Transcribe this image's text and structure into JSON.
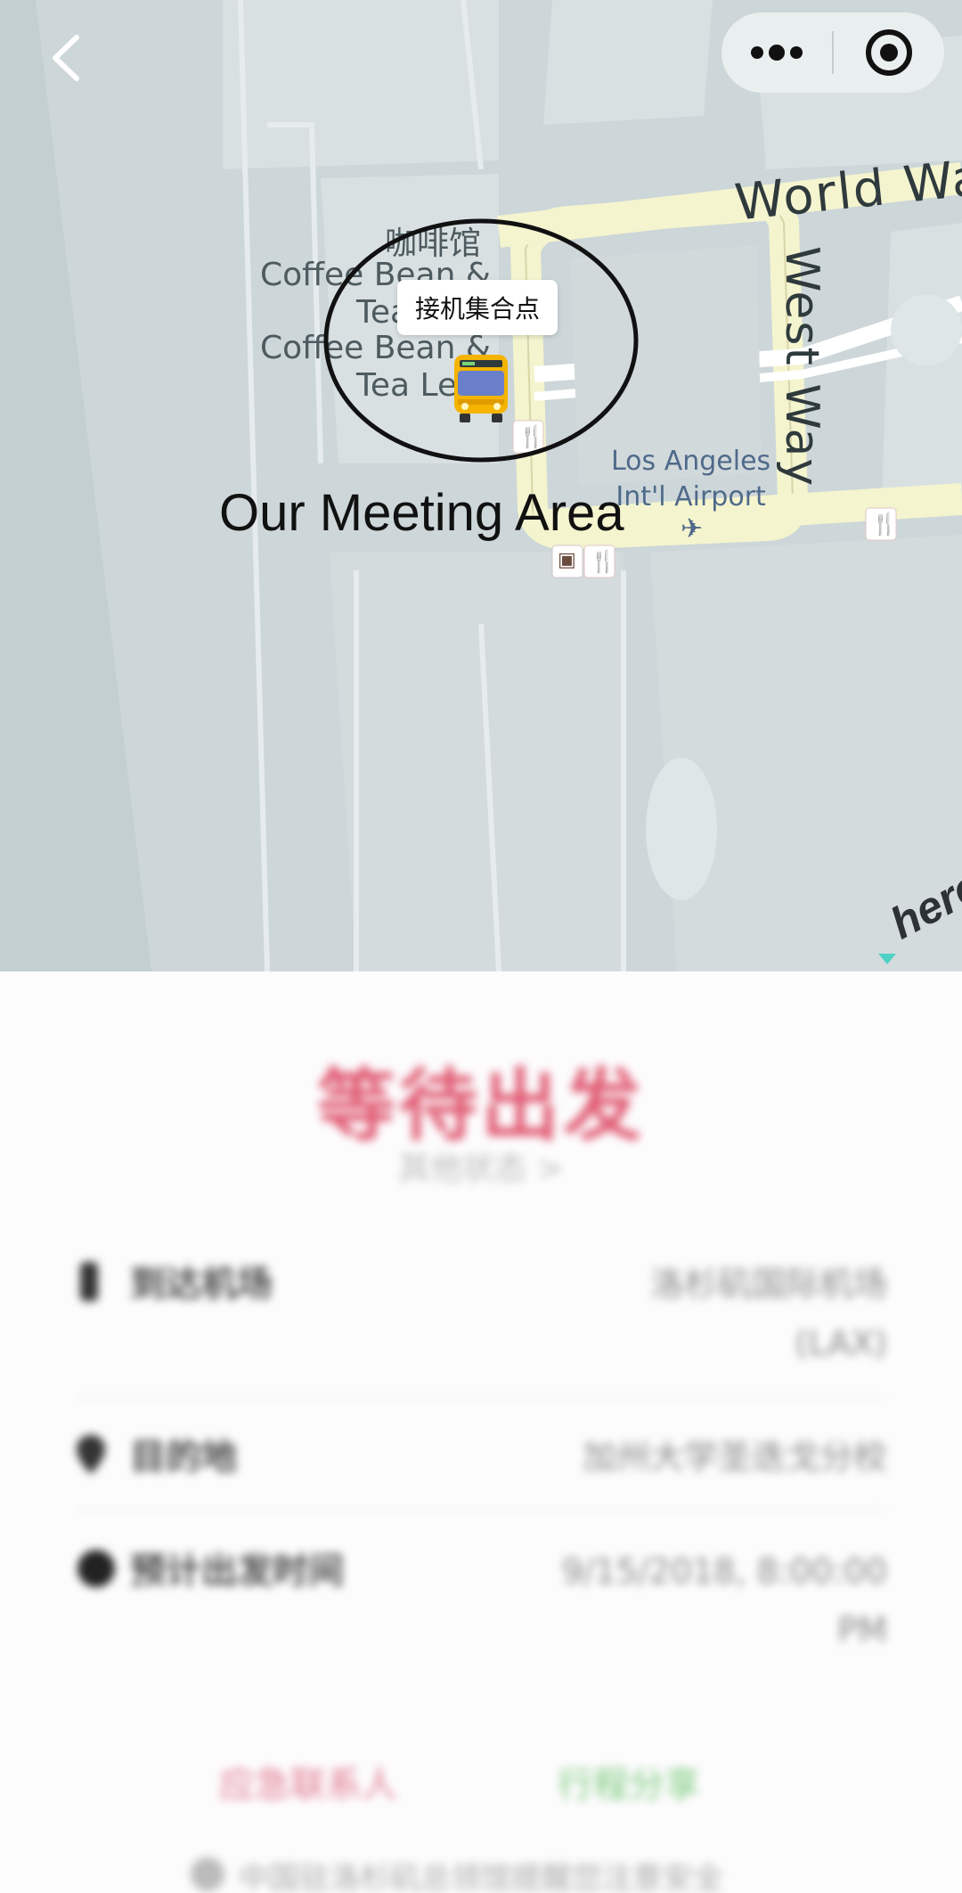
{
  "map": {
    "poi_cafe_cn": "咖啡馆",
    "poi_cafe_en_1": [
      "Coffee Bean &",
      "Tea Le"
    ],
    "poi_cafe_en_2": [
      "Coffee Bean &",
      "Tea Le"
    ],
    "road_world_way": "World  Way",
    "road_west_way": "West Way",
    "poi_airport": [
      "Los Angeles",
      "Int'l Airport"
    ],
    "pickup_bubble": "接机集合点",
    "meeting_annotation": "Our Meeting Area",
    "attribution": "here",
    "icons": {
      "back": "chevron-left-icon",
      "more": "more-dots-icon",
      "close": "target-circle-icon",
      "bus": "bus-icon",
      "restaurant": "fork-knife-icon",
      "atm": "atm-icon",
      "airport": "airplane-icon"
    }
  },
  "panel": {
    "status_title": "等待出发",
    "status_sub": "其他状态 >",
    "rows": [
      {
        "label": "到达机场",
        "value": [
          "洛杉矶国际机场",
          "(LAX)"
        ]
      },
      {
        "label": "目的地",
        "value": [
          "加州大学圣迭戈分校"
        ]
      },
      {
        "label": "预计出发时间",
        "value": [
          "9/15/2018, 8:00:00",
          "PM"
        ]
      }
    ],
    "btn_emergency": "应急联系人",
    "btn_share": "行程分享",
    "footer": "中国驻洛杉矶总领馆提醒您注意安全"
  },
  "colors": {
    "map_bg": "#cdd6d8",
    "road_fill": "#f7f7d6",
    "status_red": "#e05a72",
    "share_green": "#79c97b"
  }
}
